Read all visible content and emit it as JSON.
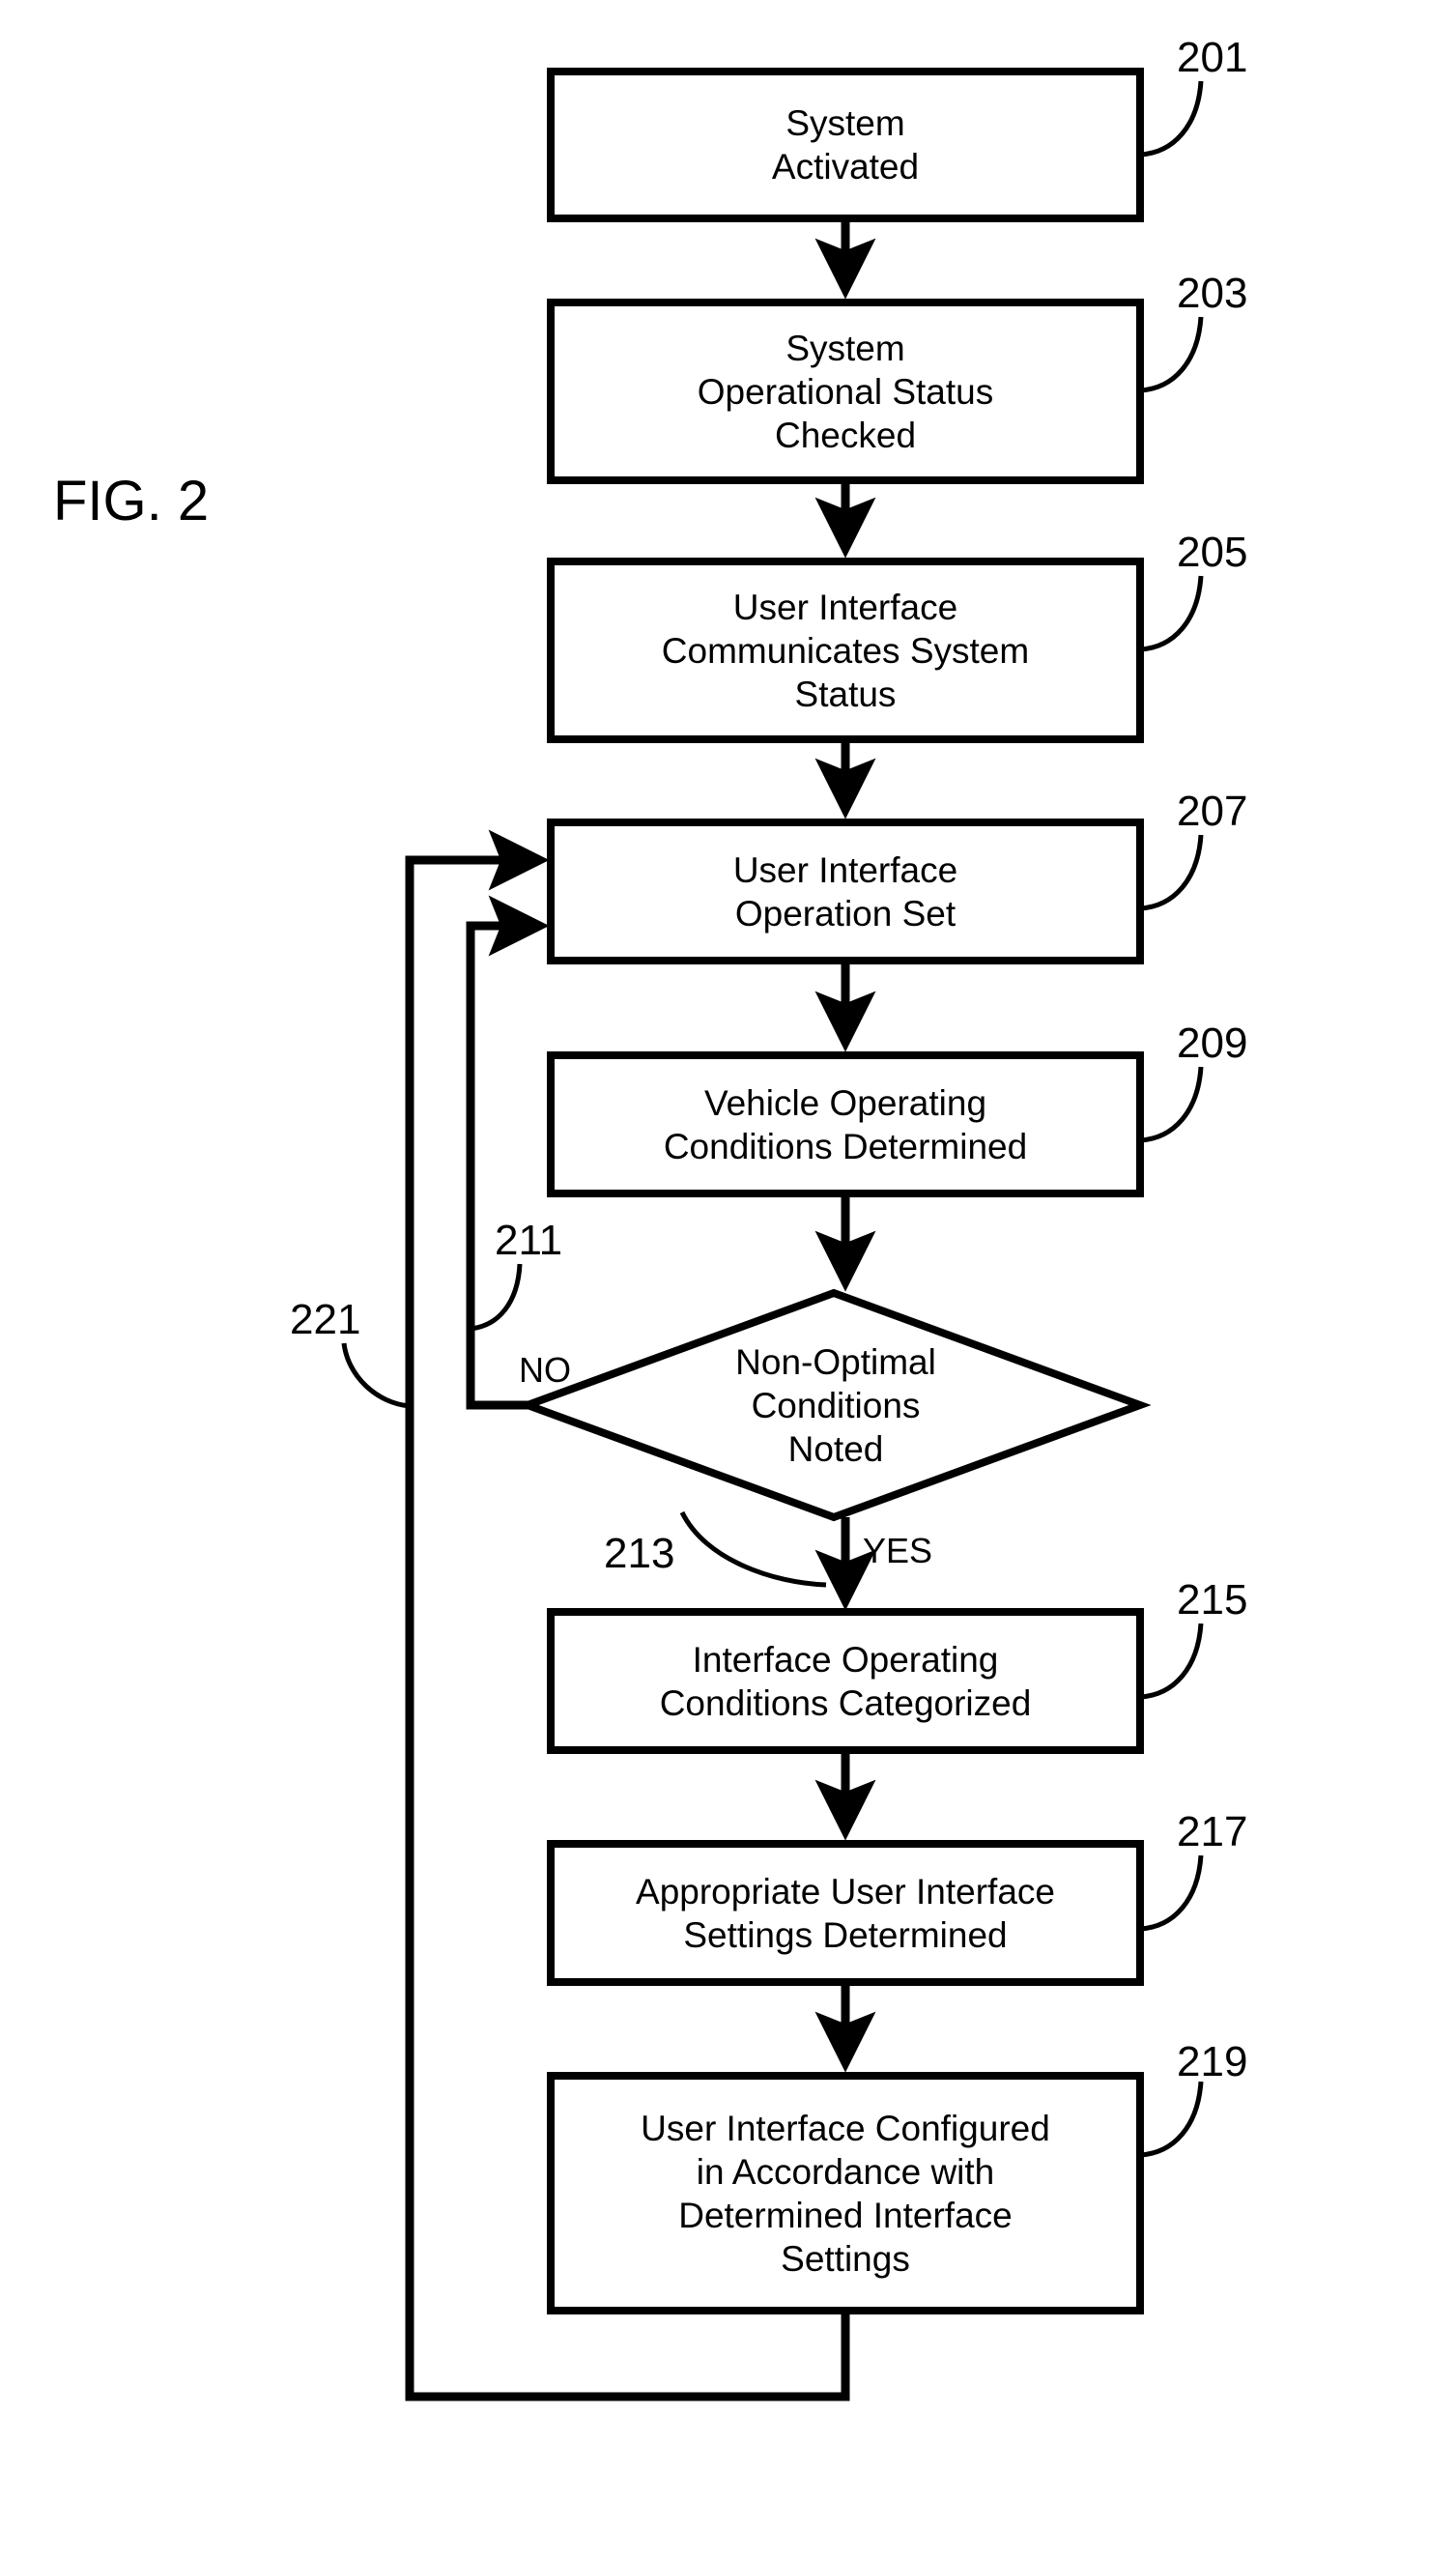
{
  "figure": {
    "label": "FIG. 2",
    "type": "flowchart"
  },
  "chart_data": {
    "type": "diagram",
    "title": "FIG. 2",
    "nodes": [
      {
        "ref": "201",
        "shape": "process",
        "text": "System\nActivated"
      },
      {
        "ref": "203",
        "shape": "process",
        "text": "System\nOperational Status\nChecked"
      },
      {
        "ref": "205",
        "shape": "process",
        "text": "User Interface\nCommunicates System\nStatus"
      },
      {
        "ref": "207",
        "shape": "process",
        "text": "User Interface\nOperation Set"
      },
      {
        "ref": "209",
        "shape": "process",
        "text": "Vehicle Operating\nConditions Determined"
      },
      {
        "ref": "213",
        "shape": "decision",
        "text": "Non-Optimal\nConditions\nNoted"
      },
      {
        "ref": "215",
        "shape": "process",
        "text": "Interface Operating\nConditions Categorized"
      },
      {
        "ref": "217",
        "shape": "process",
        "text": "Appropriate User Interface\nSettings Determined"
      },
      {
        "ref": "219",
        "shape": "process",
        "text": "User Interface Configured\nin Accordance with\nDetermined Interface\nSettings"
      }
    ],
    "edges": [
      {
        "from": "201",
        "to": "203",
        "label": ""
      },
      {
        "from": "203",
        "to": "205",
        "label": ""
      },
      {
        "from": "205",
        "to": "207",
        "label": ""
      },
      {
        "from": "207",
        "to": "209",
        "label": ""
      },
      {
        "from": "209",
        "to": "213",
        "label": ""
      },
      {
        "from": "213",
        "to": "207",
        "label": "NO",
        "ref": "211"
      },
      {
        "from": "213",
        "to": "215",
        "label": "YES"
      },
      {
        "from": "215",
        "to": "217",
        "label": ""
      },
      {
        "from": "217",
        "to": "219",
        "label": ""
      },
      {
        "from": "219",
        "to": "207",
        "label": "",
        "ref": "221"
      }
    ],
    "branch_labels": [
      "NO",
      "YES"
    ],
    "reference_numerals": [
      "201",
      "203",
      "205",
      "207",
      "209",
      "211",
      "213",
      "215",
      "217",
      "219",
      "221"
    ]
  },
  "nodes": {
    "n201": {
      "text": "System\nActivated",
      "ref": "201"
    },
    "n203": {
      "text": "System\nOperational Status\nChecked",
      "ref": "203"
    },
    "n205": {
      "text": "User Interface\nCommunicates System\nStatus",
      "ref": "205"
    },
    "n207": {
      "text": "User Interface\nOperation Set",
      "ref": "207"
    },
    "n209": {
      "text": "Vehicle Operating\nConditions Determined",
      "ref": "209"
    },
    "n213": {
      "text": "Non-Optimal\nConditions\nNoted",
      "ref": "213"
    },
    "n215": {
      "text": "Interface Operating\nConditions Categorized",
      "ref": "215"
    },
    "n217": {
      "text": "Appropriate User Interface\nSettings Determined",
      "ref": "217"
    },
    "n219": {
      "text": "User Interface Configured\nin Accordance with\nDetermined Interface\nSettings",
      "ref": "219"
    }
  },
  "labels": {
    "no": "NO",
    "yes": "YES",
    "ref211": "211",
    "ref221": "221"
  },
  "colors": {
    "stroke": "#000000",
    "background": "#ffffff",
    "text": "#000000"
  }
}
